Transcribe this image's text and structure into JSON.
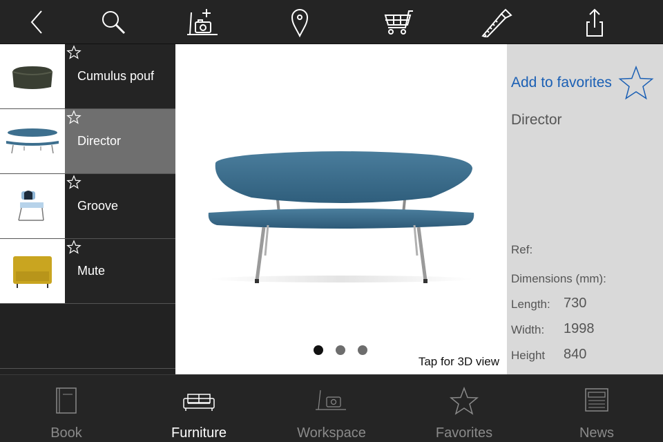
{
  "toolbar": {
    "buttons": [
      {
        "name": "back-icon"
      },
      {
        "name": "search-icon"
      },
      {
        "name": "add-photo-icon"
      },
      {
        "name": "location-pin-icon"
      },
      {
        "name": "cart-icon"
      },
      {
        "name": "saw-icon"
      },
      {
        "name": "share-icon"
      }
    ]
  },
  "products": [
    {
      "label": "Cumulus pouf",
      "thumb": "cumulus-pouf-thumb",
      "selected": false
    },
    {
      "label": "Director",
      "thumb": "director-thumb",
      "selected": true
    },
    {
      "label": "Groove",
      "thumb": "groove-thumb",
      "selected": false
    },
    {
      "label": "Mute",
      "thumb": "mute-thumb",
      "selected": false
    }
  ],
  "viewer": {
    "image": "director-sofa-image",
    "page_count": 3,
    "current_page": 1,
    "tap_label": "Tap for 3D view"
  },
  "details": {
    "add_favorites": "Add to favorites",
    "name": "Director",
    "ref_label": "Ref:",
    "dimensions_label": "Dimensions (mm):",
    "length_label": "Length:",
    "length_value": "730",
    "width_label": "Width:",
    "width_value": "1998",
    "height_label": "Height",
    "height_value": "840"
  },
  "tabs": [
    {
      "label": "Book",
      "icon": "book-icon",
      "active": false
    },
    {
      "label": "Furniture",
      "icon": "sofa-icon",
      "active": true
    },
    {
      "label": "Workspace",
      "icon": "workspace-photo-icon",
      "active": false
    },
    {
      "label": "Favorites",
      "icon": "star-icon",
      "active": false
    },
    {
      "label": "News",
      "icon": "newspaper-icon",
      "active": false
    }
  ],
  "colors": {
    "accent_link": "#1a5fb4",
    "bar_background": "#242424",
    "selected_row": "#6f6f6f",
    "details_background": "#d9d9d9",
    "sofa_blue": "#3d6f8e"
  }
}
